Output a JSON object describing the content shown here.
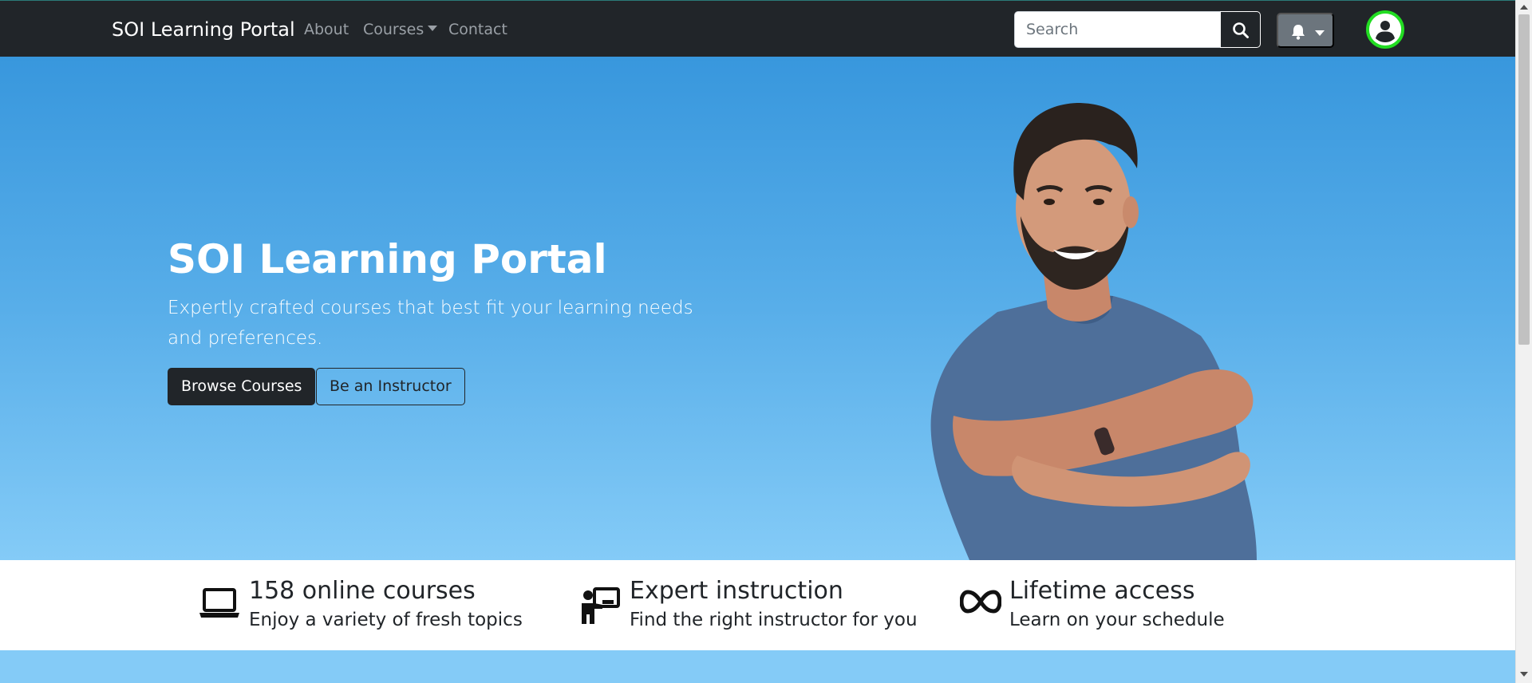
{
  "navbar": {
    "brand": "SOI Learning Portal",
    "links": {
      "about": "About",
      "courses": "Courses",
      "contact": "Contact"
    },
    "search": {
      "placeholder": "Search",
      "value": "",
      "button_icon": "search-icon"
    },
    "notifications": {
      "icon": "bell-icon",
      "dropdown_icon": "caret-down-icon"
    },
    "profile": {
      "icon": "user-circle-icon",
      "ring_color": "#22dd22"
    }
  },
  "hero": {
    "title": "SOI Learning Portal",
    "subtitle": "Expertly crafted courses that best fit your learning needs and preferences.",
    "primary_button": "Browse Courses",
    "secondary_button": "Be an Instructor",
    "gradient_top": "#3897dd",
    "gradient_bottom": "#84cbf7"
  },
  "features": [
    {
      "icon": "laptop-icon",
      "title": "158 online courses",
      "description": "Enjoy a variety of fresh topics"
    },
    {
      "icon": "chalkboard-teacher-icon",
      "title": "Expert instruction",
      "description": "Find the right instructor for you"
    },
    {
      "icon": "infinity-icon",
      "title": "Lifetime access",
      "description": "Learn on your schedule"
    }
  ],
  "colors": {
    "navbar_bg": "#212529",
    "nav_link": "#9aa0a6",
    "button_dark": "#212529",
    "notif_button_bg": "#6c757d"
  }
}
